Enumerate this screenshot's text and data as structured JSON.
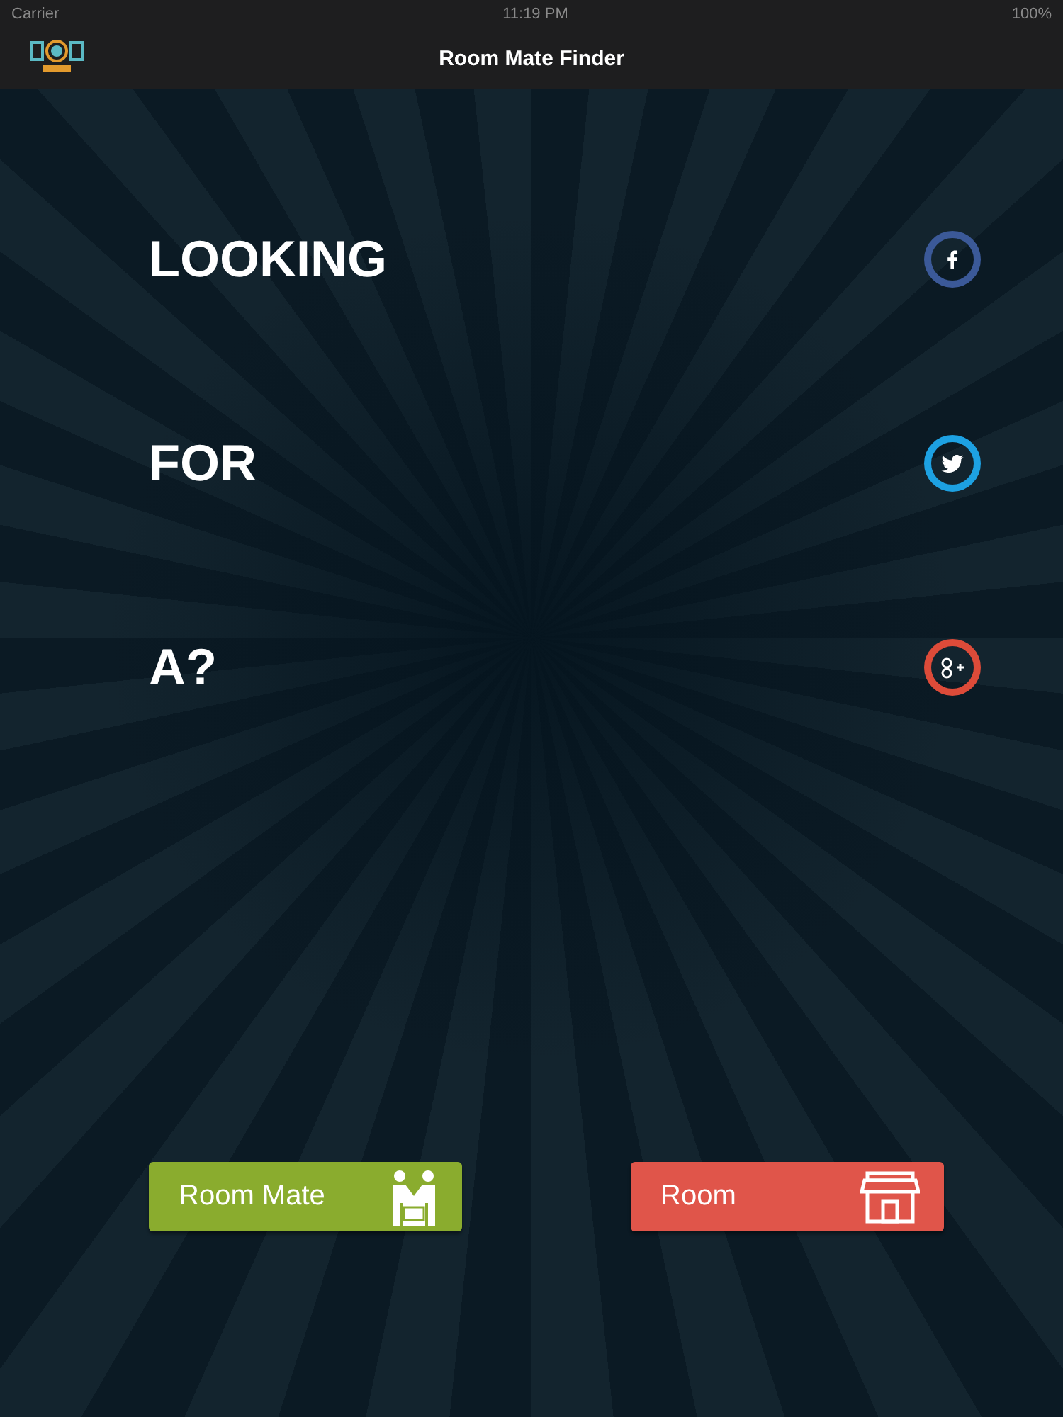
{
  "status_bar": {
    "carrier": "Carrier",
    "time": "11:19 PM",
    "battery": "100%"
  },
  "nav_bar": {
    "title": "Room Mate Finder"
  },
  "rows": [
    {
      "word": "LOOKING",
      "social": {
        "kind": "facebook",
        "color": "#3b5998"
      }
    },
    {
      "word": "FOR",
      "social": {
        "kind": "twitter",
        "color": "#1da1e2"
      }
    },
    {
      "word": "A?",
      "social": {
        "kind": "googleplus",
        "color": "#dd4b39"
      }
    }
  ],
  "buttons": [
    {
      "label": "Room Mate",
      "kind": "roommate",
      "color": "#8aac2e"
    },
    {
      "label": "Room",
      "kind": "room",
      "color": "#e0554a"
    }
  ]
}
